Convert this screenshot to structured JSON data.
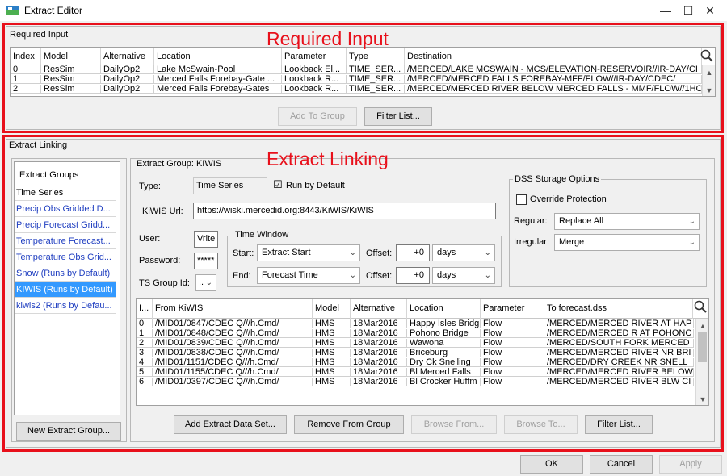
{
  "window": {
    "title": "Extract Editor",
    "minimize_glyph": "—",
    "maximize_glyph": "☐",
    "close_glyph": "✕"
  },
  "annotations": {
    "required_input": "Required Input",
    "extract_linking": "Extract Linking",
    "color": "#e8101b"
  },
  "required_input": {
    "label": "Required Input",
    "columns": [
      "Index",
      "Model",
      "Alternative",
      "Location",
      "Parameter",
      "Type",
      "Destination"
    ],
    "rows": [
      [
        "0",
        "ResSim",
        "DailyOp2",
        "Lake McSwain-Pool",
        "Lookback El...",
        "TIME_SER...",
        "/MERCED/LAKE MCSWAIN - MCS/ELEVATION-RESERVOIR//IR-DAY/CI"
      ],
      [
        "1",
        "ResSim",
        "DailyOp2",
        "Merced Falls Forebay-Gate ...",
        "Lookback R...",
        "TIME_SER...",
        "/MERCED/MERCED FALLS FOREBAY-MFF/FLOW//IR-DAY/CDEC/"
      ],
      [
        "2",
        "ResSim",
        "DailyOp2",
        "Merced Falls Forebay-Gates",
        "Lookback R...",
        "TIME_SER...",
        "/MERCED/MERCED RIVER BELOW MERCED FALLS - MMF/FLOW//1HO"
      ]
    ],
    "add_to_group": "Add To Group",
    "filter_list": "Filter List..."
  },
  "extract_linking": {
    "label": "Extract Linking",
    "groups_header": "Extract Groups",
    "groups": [
      "Time Series",
      "Precip Obs Gridded D...",
      "Precip Forecast Gridd...",
      "Temperature Forecast...",
      "Temperature Obs Grid...",
      "Snow (Runs by Default)",
      "KIWIS (Runs by Default)",
      "kiwis2 (Runs by Defau..."
    ],
    "selected_group": "KIWIS (Runs by Default)",
    "new_group_button": "New Extract Group...",
    "group_title": "Extract Group: KIWIS",
    "type_label": "Type:",
    "type_value": "Time Series",
    "run_by_default_label": "Run by Default",
    "run_by_default_checked": "☑",
    "kiwis_url_label": "KiWIS Url:",
    "kiwis_url_value": "https://wiski.mercedid.org:8443/KiWIS/KiWIS",
    "user_label": "User:",
    "user_value": "Vrite",
    "password_label": "Password:",
    "password_value": "*****",
    "ts_group_label": "TS Group Id:",
    "ts_group_value": "..",
    "time_window_label": "Time Window",
    "start_label": "Start:",
    "start_value": "Extract Start",
    "end_label": "End:",
    "end_value": "Forecast Time",
    "offset_label": "Offset:",
    "start_offset": "+0",
    "end_offset": "+0",
    "start_unit": "days",
    "end_unit": "days",
    "dss_label": "DSS Storage Options",
    "override_label": "Override Protection",
    "regular_label": "Regular:",
    "regular_value": "Replace All",
    "irregular_label": "Irregular:",
    "irregular_value": "Merge",
    "columns": [
      "I...",
      "From KiWIS",
      "Model",
      "Alternative",
      "Location",
      "Parameter",
      "To forecast.dss"
    ],
    "rows": [
      [
        "0",
        "/MID01/0847/CDEC  Q///h.Cmd/",
        "HMS",
        "18Mar2016",
        "Happy Isles Bridg",
        "Flow",
        "/MERCED/MERCED RIVER AT HAP"
      ],
      [
        "1",
        "/MID01/0848/CDEC  Q///h.Cmd/",
        "HMS",
        "18Mar2016",
        "Pohono Bridge",
        "Flow",
        "/MERCED/MERCED R AT POHONC"
      ],
      [
        "2",
        "/MID01/0839/CDEC  Q///h.Cmd/",
        "HMS",
        "18Mar2016",
        "Wawona",
        "Flow",
        "/MERCED/SOUTH FORK MERCED"
      ],
      [
        "3",
        "/MID01/0838/CDEC  Q///h.Cmd/",
        "HMS",
        "18Mar2016",
        "Briceburg",
        "Flow",
        "/MERCED/MERCED RIVER NR BRI"
      ],
      [
        "4",
        "/MID01/1151/CDEC  Q///h.Cmd/",
        "HMS",
        "18Mar2016",
        "Dry Ck Snelling",
        "Flow",
        "/MERCED/DRY CREEK NR SNELL"
      ],
      [
        "5",
        "/MID01/1155/CDEC  Q///h.Cmd/",
        "HMS",
        "18Mar2016",
        "Bl Merced Falls",
        "Flow",
        "/MERCED/MERCED RIVER BELOW"
      ],
      [
        "6",
        "/MID01/0397/CDEC  Q///h.Cmd/",
        "HMS",
        "18Mar2016",
        "Bl Crocker Huffm",
        "Flow",
        "/MERCED/MERCED RIVER BLW CI"
      ]
    ],
    "add_data_set": "Add Extract Data Set...",
    "remove_from_group": "Remove From Group",
    "browse_from": "Browse From...",
    "browse_to": "Browse To...",
    "filter_list": "Filter List..."
  },
  "footer": {
    "ok": "OK",
    "cancel": "Cancel",
    "apply": "Apply"
  },
  "colors": {
    "selection": "#3399ff",
    "link_text": "#1f3ec0",
    "highlight_red": "#e8101b"
  }
}
